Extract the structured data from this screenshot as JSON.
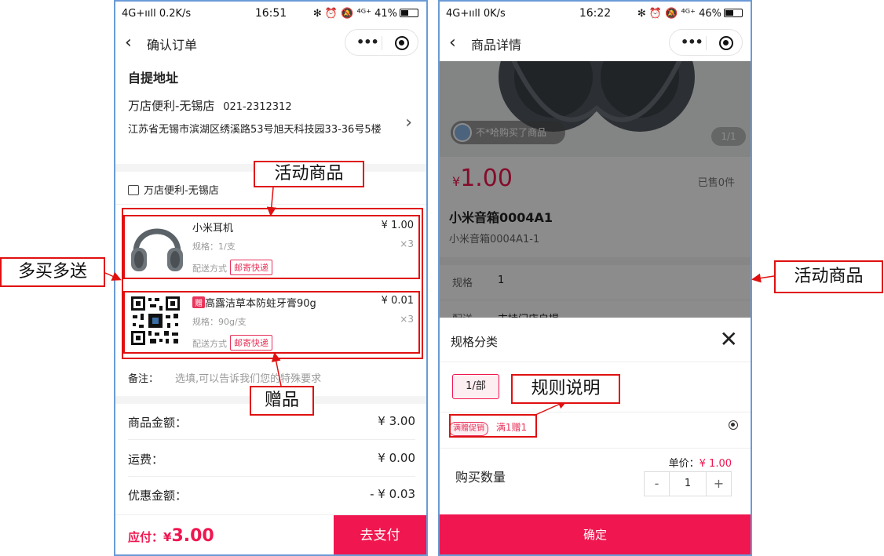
{
  "annotations": {
    "buy_more_give_more": "多买多送",
    "activity_product_top": "活动商品",
    "gift": "赠品",
    "activity_product_right": "活动商品",
    "rule_explain": "规则说明"
  },
  "phone1": {
    "status": {
      "network": "4G+ııll 0.2K/s",
      "time": "16:51",
      "right": "✻ ⏰ 🔕 ⁴ᴳ⁺ 41%"
    },
    "battery_pct": 41,
    "nav_title": "确认订单",
    "pickup": {
      "heading": "自提地址",
      "store": "万店便利-无锡店",
      "phone": "021-2312312",
      "address": "江苏省无锡市滨湖区绣溪路53号旭天科技园33-36号5楼"
    },
    "shop_name": "万店便利-无锡店",
    "items": [
      {
        "name": "小米耳机",
        "price": "¥ 1.00",
        "spec": "规格：1/支",
        "qty": "×3",
        "ship_label": "配送方式",
        "ship_tag": "邮寄快递"
      },
      {
        "gift_badge": "赠",
        "name": "高露洁草本防蛀牙膏90g",
        "price": "¥ 0.01",
        "spec": "规格：90g/支",
        "qty": "×3",
        "ship_label": "配送方式",
        "ship_tag": "邮寄快递"
      }
    ],
    "remark": {
      "label": "备注：",
      "placeholder": "选填,可以告诉我们您的特殊要求"
    },
    "summary": [
      {
        "label": "商品金额：",
        "value": "¥ 3.00"
      },
      {
        "label": "运费：",
        "value": "¥ 0.00"
      },
      {
        "label": "优惠金额：",
        "value": "- ¥ 0.03"
      }
    ],
    "footer": {
      "pay_label": "应付：",
      "currency": "¥",
      "amount": "3.00",
      "pay_button": "去支付"
    }
  },
  "phone2": {
    "status": {
      "network": "4G+ııll 0K/s",
      "time": "16:22",
      "right": "✻ ⏰ 🔕 ⁴ᴳ⁺ 46%"
    },
    "battery_pct": 46,
    "nav_title": "商品详情",
    "purchase_notice": "不*哈购买了商品",
    "image_counter": "1/1",
    "price_currency": "¥",
    "price": "1.00",
    "sold": "已售0件",
    "product_name": "小米音箱0004A1",
    "product_sub": "小米音箱0004A1-1",
    "spec_row": {
      "label": "规格",
      "value": "1"
    },
    "delivery_row": {
      "label": "配送",
      "value": "支持门店自提"
    },
    "sheet": {
      "title": "规格分类",
      "option": "1/部",
      "promo_tag": "满赠促销",
      "promo_text": "满1赠1",
      "unit_price_label": "单价：",
      "unit_price": "¥ 1.00",
      "qty_label": "购买数量",
      "minus": "-",
      "qty": "1",
      "plus": "+",
      "confirm": "确定"
    }
  },
  "colors": {
    "accent": "#f0164f",
    "red_box": "#e01010",
    "tag": "#e8335a",
    "frame": "#6b9bd6"
  }
}
